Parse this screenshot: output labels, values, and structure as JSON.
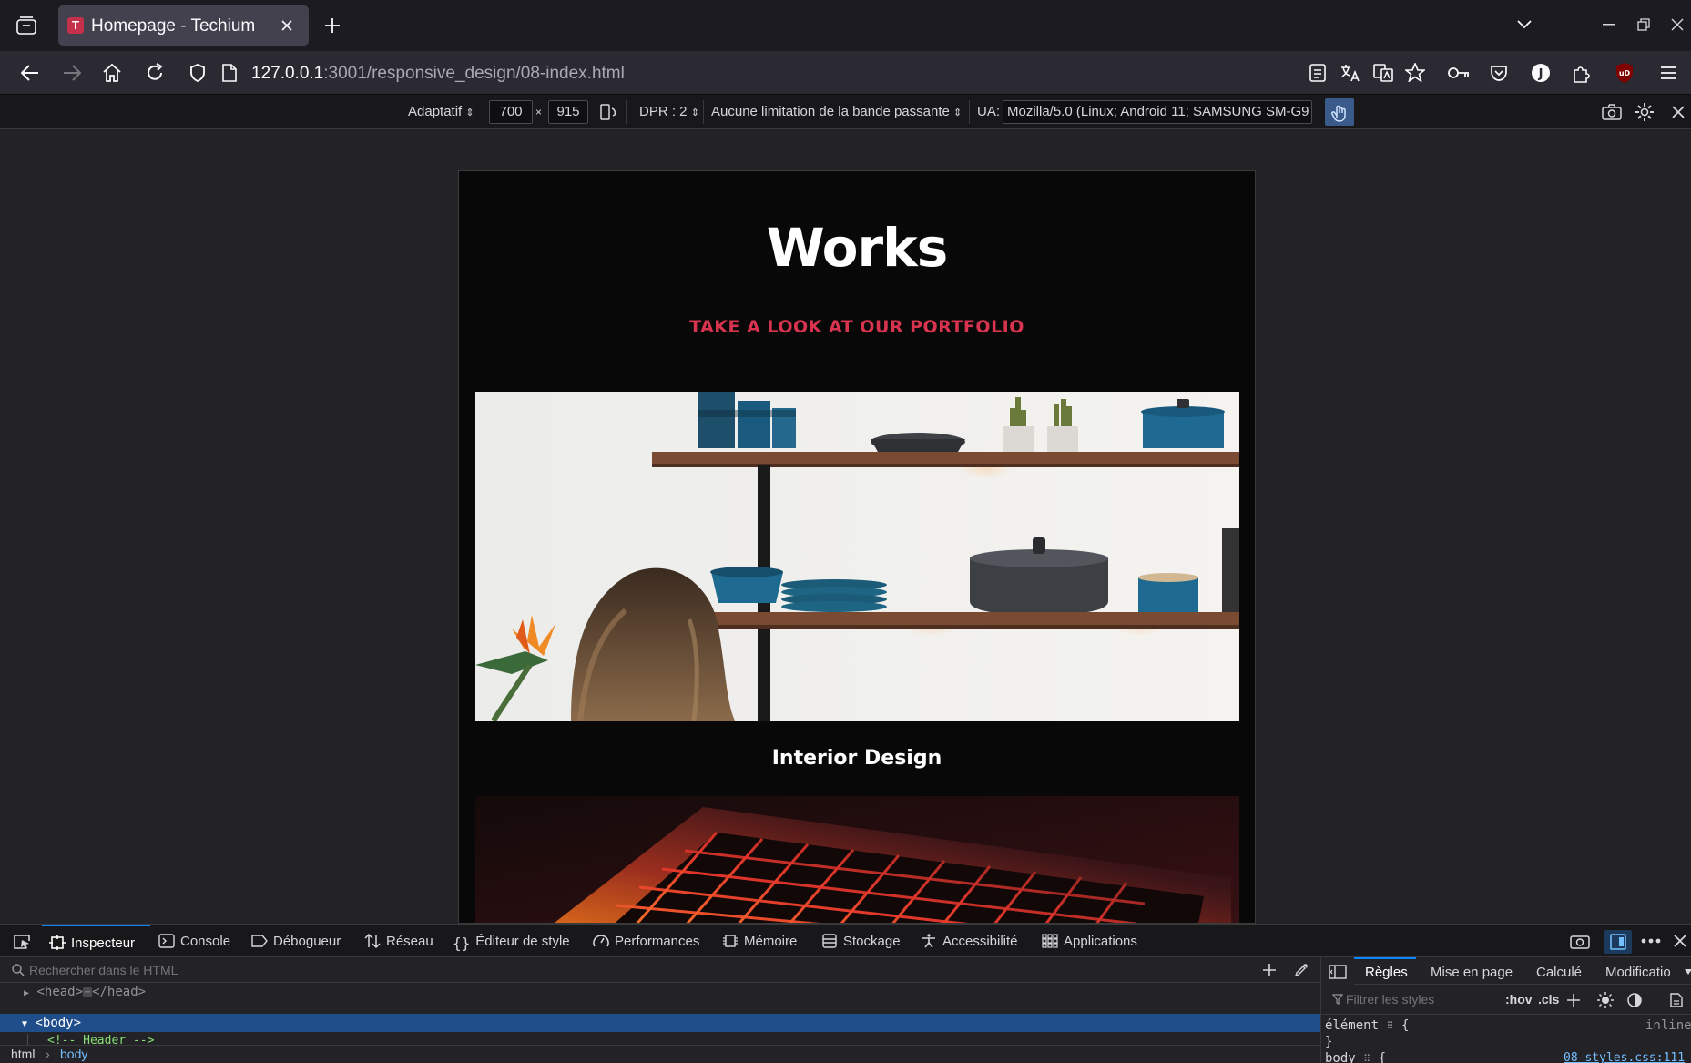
{
  "browser": {
    "tab_title": "Homepage - Techium",
    "tab_favicon_letter": "T",
    "url_host": "127.0.0.1",
    "url_rest": ":3001/responsive_design/08-index.html",
    "extension_badge": "uD"
  },
  "rdm": {
    "device": "Adaptatif",
    "width": "700",
    "times": "×",
    "height": "915",
    "dpr": "DPR : 2",
    "throttling": "Aucune limitation de la bande passante",
    "ua_label": "UA:",
    "ua_value": "Mozilla/5.0 (Linux; Android 11; SAMSUNG SM-G97"
  },
  "page": {
    "title": "Works",
    "subtitle": "TAKE A LOOK AT OUR PORTFOLIO",
    "items": [
      {
        "caption": "Interior Design"
      }
    ]
  },
  "devtools": {
    "tabs": [
      "Inspecteur",
      "Console",
      "Débogueur",
      "Réseau",
      "Éditeur de style",
      "Performances",
      "Mémoire",
      "Stockage",
      "Accessibilité",
      "Applications"
    ],
    "search_placeholder": "Rechercher dans le HTML",
    "html_lines": {
      "head": "<head>",
      "head_close": "</head>",
      "body": "<body>",
      "comment": "<!-- Header -->"
    },
    "breadcrumbs": [
      "html",
      "body"
    ],
    "side_tabs": [
      "Règles",
      "Mise en page",
      "Calculé",
      "Modificatio"
    ],
    "filter_placeholder": "Filtrer les styles",
    "hov": ":hov",
    "cls": ".cls",
    "rule_selector": "élément",
    "rule_open": "{",
    "rule_close": "}",
    "rule_source": "inline",
    "rule2_selector": "body",
    "rule2_source": "08-styles.css:111"
  },
  "colors": {
    "accent": "#d8344f",
    "selection": "#204e8a",
    "devtools_active": "#0a84ff"
  }
}
